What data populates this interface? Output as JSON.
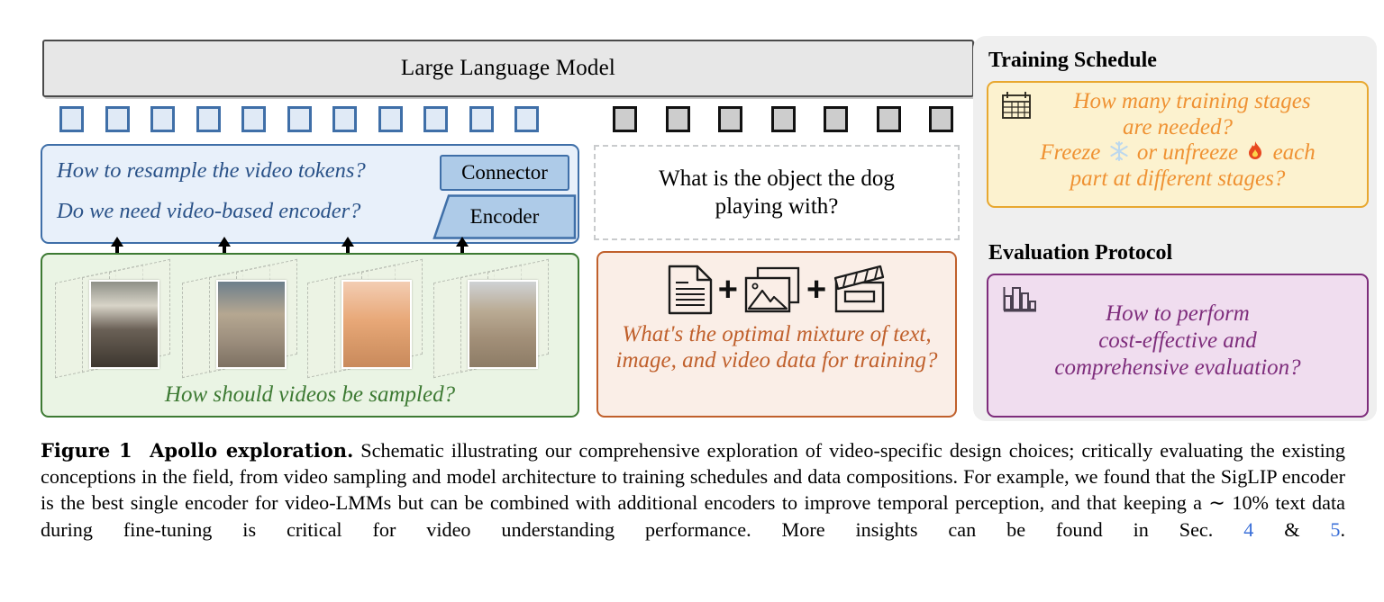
{
  "figure": {
    "llm_label": "Large Language Model",
    "tokens": {
      "blue_count": 11,
      "gray_count": 7,
      "blue_fill": "#e0eaf6",
      "blue_border": "#3f6fa8",
      "gray_fill": "#cdcdcd",
      "gray_border": "#111111"
    },
    "model_panel": {
      "question_1": "How to resample the video tokens?",
      "question_2": "Do we need video-based encoder?",
      "connector_label": "Connector",
      "encoder_label": "Encoder",
      "accent": "#3f6fa8",
      "fill": "#e8f0fa"
    },
    "video_panel": {
      "caption": "How should videos be sampled?",
      "accent": "#3d7a33",
      "fill": "#eaf4e4",
      "frame_groups": 4
    },
    "qa_box": {
      "text": "What is the object the dog playing with?"
    },
    "data_panel": {
      "icons": [
        "document-icon",
        "images-icon",
        "clapperboard-icon"
      ],
      "separator": "+",
      "caption": "What's the optimal mixture of text, image, and video data for training?",
      "accent": "#c0602c",
      "fill": "#faeee7"
    },
    "training_schedule": {
      "title": "Training Schedule",
      "icon": "calendar-icon",
      "line_1": "How many training stages",
      "line_2": "are needed?",
      "line_3_a": "Freeze",
      "line_3_icon_a": "snowflake-icon",
      "line_3_b": "or unfreeze",
      "line_3_icon_b": "fire-icon",
      "line_3_c": "each",
      "line_4": "part at different stages?",
      "accent": "#e8a830",
      "text_color": "#ef9233",
      "fill": "#fcf2cf"
    },
    "evaluation_protocol": {
      "title": "Evaluation Protocol",
      "icon": "bar-chart-icon",
      "line_1": "How to perform",
      "line_2": "cost-effective and",
      "line_3": "comprehensive evaluation?",
      "accent": "#7e2d7c",
      "text_color": "#7e2d7c",
      "fill": "#f0ddef"
    }
  },
  "caption": {
    "label": "Figure 1",
    "bold_title": "Apollo exploration.",
    "body_1": "Schematic illustrating our comprehensive exploration of video-specific design choices; critically evaluating the existing conceptions in the field, from video sampling and model architecture to training schedules and data compositions. For example, we found that the SigLIP encoder is the best single encoder for video-LMMs but can be combined with additional encoders to improve temporal perception, and that keeping a ∼ 10% text data during fine-tuning is critical for video understanding performance. More insights can be found in Sec.",
    "ref_1": "4",
    "amp": "&",
    "ref_2": "5",
    "period": "."
  }
}
